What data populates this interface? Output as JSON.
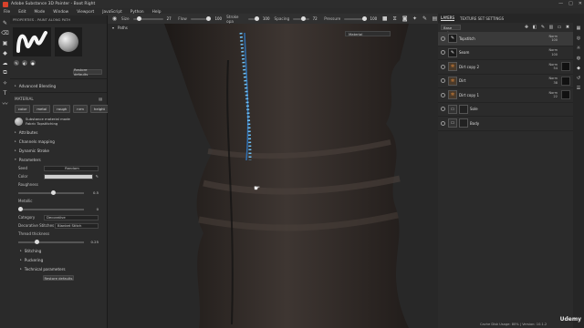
{
  "window": {
    "title": "Adobe Substance 3D Painter - Boot Right",
    "controls": [
      "—",
      "□",
      "✕"
    ]
  },
  "menu": [
    "File",
    "Edit",
    "Mode",
    "Window",
    "Viewport",
    "JavaScript",
    "Python",
    "Help"
  ],
  "toolbar": {
    "size_label": "Size",
    "size_value": "27",
    "flow_label": "Flow",
    "flow_value": "100",
    "stroke_label": "Stroke opa",
    "stroke_value": "100",
    "spacing_label": "Spacing",
    "spacing_value": "72",
    "pressure_label": "Pressure",
    "pressure_value": "100"
  },
  "properties": {
    "header": "PROPERTIES - PAINT ALONG PATH",
    "restore_label": "Restore defaults",
    "advanced_blending": "Advanced Blending",
    "material_label": "MATERIAL",
    "chips": [
      "color",
      "metal",
      "rough",
      "nrm",
      "height"
    ],
    "material_name": "Substance material mode",
    "material_sub": "Fabric Topstitching",
    "sections": [
      "Attributes",
      "Channels mapping",
      "Dynamic Stroke",
      "Parameters"
    ],
    "params": {
      "seed_label": "Seed",
      "seed_value": "Random",
      "color_label": "Color",
      "roughness_label": "Roughness",
      "roughness_value": "0.5",
      "metallic_label": "Metallic",
      "metallic_value": "0",
      "category_label": "Category",
      "category_value": "Decorative",
      "dstitches_label": "Decorative Stitches",
      "dstitches_value": "Blanket Stitch",
      "thickness_label": "Thread thickness",
      "thickness_value": "0.25",
      "roughness_level": 0.5,
      "thickness_level": 0.25
    },
    "subsections": [
      "Stitching",
      "Puckering",
      "Technical parameters"
    ],
    "restore2": "Restore defaults"
  },
  "viewport": {
    "paths_label": "Paths",
    "channel_select": "Material"
  },
  "layers_panel": {
    "tab_layers": "LAYERS",
    "tab_texture": "TEXTURE SET SETTINGS",
    "blend_mode": "Base colour",
    "layers": [
      {
        "name": "Topstitch",
        "blend": "Norm",
        "opacity": "100",
        "type": "paint"
      },
      {
        "name": "Seam",
        "blend": "Norm",
        "opacity": "100",
        "type": "paint"
      },
      {
        "name": "Dirt copy 2",
        "blend": "Norm",
        "opacity": "54",
        "type": "fill"
      },
      {
        "name": "Dirt",
        "blend": "Norm",
        "opacity": "38",
        "type": "fill"
      },
      {
        "name": "Dirt copy 1",
        "blend": "Norm",
        "opacity": "22",
        "type": "fill"
      },
      {
        "name": "Sole",
        "blend": "",
        "opacity": "",
        "type": "folder"
      },
      {
        "name": "Body",
        "blend": "",
        "opacity": "",
        "type": "folder"
      }
    ]
  },
  "status": {
    "text": "Cache Disk Usage: 80% | Version: 10.1.2"
  },
  "watermark": "Udemy",
  "colors": {
    "accent": "#3a7bd5",
    "stitch_blue": "#4aa3e8",
    "leather": "#2a2422"
  }
}
